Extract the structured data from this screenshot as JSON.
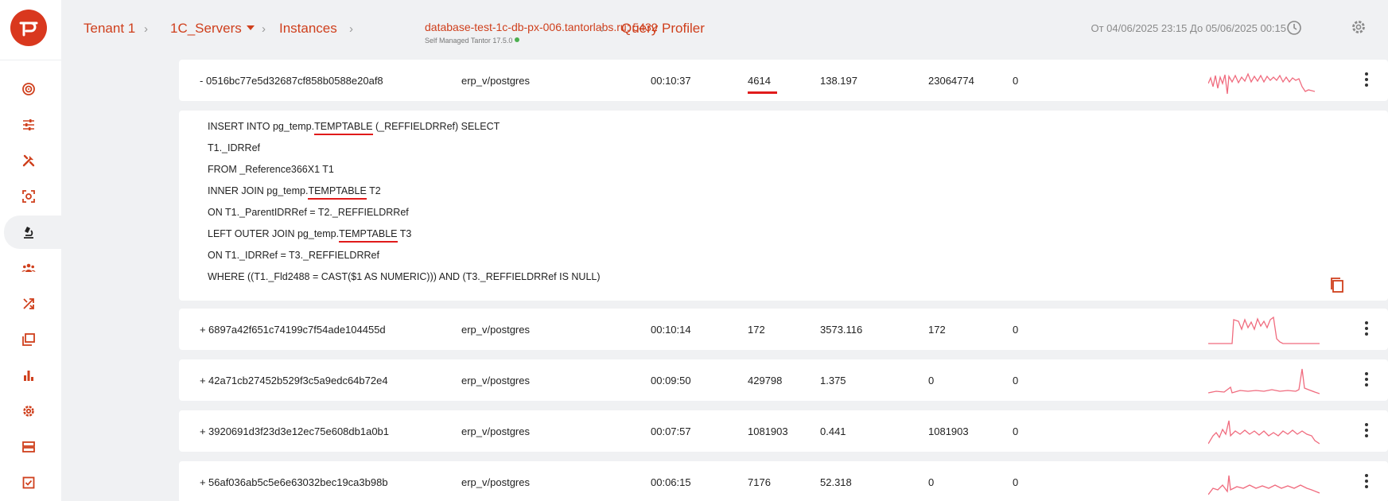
{
  "app": {
    "logo_icon": "tantor-logo-icon",
    "accent": "#cf3f1c"
  },
  "sidebar": {
    "items": [
      {
        "icon": "target-icon"
      },
      {
        "icon": "sliders-icon"
      },
      {
        "icon": "tools-icon"
      },
      {
        "icon": "scan-icon"
      },
      {
        "icon": "microscope-icon",
        "active": true
      },
      {
        "icon": "users-icon"
      },
      {
        "icon": "shuffle-icon"
      },
      {
        "icon": "layers-icon"
      },
      {
        "icon": "bar-chart-icon"
      },
      {
        "icon": "gear-icon"
      },
      {
        "icon": "server-icon"
      },
      {
        "icon": "checklist-icon"
      }
    ]
  },
  "breadcrumb": {
    "tenant": "Tenant 1",
    "group": "1C_Servers",
    "instances": "Instances",
    "instance": "database-test-1c-db-px-006.tantorlabs.ru: 5432",
    "instance_sub": "Self Managed Tantor 17.5.0",
    "page": "Query Profiler"
  },
  "header": {
    "date_range": "От 04/06/2025 23:15 До 05/06/2025 00:15"
  },
  "rows": [
    {
      "toggle": "-",
      "queryid": "0516bc77e5d32687cf858b0588e20af8",
      "user_db": "erp_v/postgres",
      "time": "00:10:37",
      "calls": "4614",
      "mean": "138.197",
      "rows": "23064774",
      "other": "0"
    },
    {
      "toggle": "+",
      "queryid": "6897a42f651c74199c7f54ade104455d",
      "user_db": "erp_v/postgres",
      "time": "00:10:14",
      "calls": "172",
      "mean": "3573.116",
      "rows": "172",
      "other": "0"
    },
    {
      "toggle": "+",
      "queryid": "42a71cb27452b529f3c5a9edc64b72e4",
      "user_db": "erp_v/postgres",
      "time": "00:09:50",
      "calls": "429798",
      "mean": "1.375",
      "rows": "0",
      "other": "0"
    },
    {
      "toggle": "+",
      "queryid": "3920691d3f23d3e12ec75e608db1a0b1",
      "user_db": "erp_v/postgres",
      "time": "00:07:57",
      "calls": "1081903",
      "mean": "0.441",
      "rows": "1081903",
      "other": "0"
    },
    {
      "toggle": "+",
      "queryid": "56af036ab5c5e6e63032bec19ca3b98b",
      "user_db": "erp_v/postgres",
      "time": "00:06:15",
      "calls": "7176",
      "mean": "52.318",
      "rows": "0",
      "other": "0"
    }
  ],
  "sql": {
    "l1a": "INSERT INTO pg_temp.",
    "l1b": "TEMPTABLE",
    "l1c": " (_REFFIELDRRef) SELECT",
    "l2": "T1._IDRRef",
    "l3": "FROM _Reference366X1 T1",
    "l4a": "INNER JOIN pg_temp.",
    "l4b": "TEMPTABLE",
    "l4c": " T2",
    "l5": "ON T1._ParentIDRRef = T2._REFFIELDRRef",
    "l6a": "LEFT OUTER JOIN pg_temp.",
    "l6b": "TEMPTABLE",
    "l6c": " T3",
    "l7": "ON T1._IDRRef = T3._REFFIELDRRef",
    "l8": "WHERE ((T1._Fld2488 = CAST($1 AS NUMERIC))) AND (T3._REFFIELDRRef IS NULL)",
    "copy_icon": "copy-icon"
  },
  "colors": {
    "sparkline": "#f06b7e",
    "highlight": "#e01b1b"
  }
}
